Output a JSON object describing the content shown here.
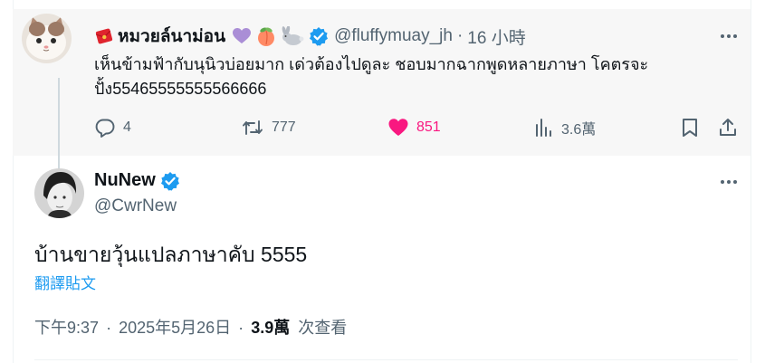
{
  "parent_tweet": {
    "display_name": "หมวยล์นาม่อน",
    "name_emojis": [
      "purple-heart",
      "peach",
      "rabbit"
    ],
    "handle": "@fluffymuay_jh",
    "separator": "·",
    "time": "16 小時",
    "text": "เห็นข้ามฟ้ากับนุนิวบ่อยมาก เด่วต้องไปดูละ ชอบมากฉากพูดหลายภาษา โคตรจะปั้ง55465555555566666",
    "stats": {
      "replies": "4",
      "retweets": "777",
      "likes": "851",
      "views": "3.6萬"
    }
  },
  "main_tweet": {
    "display_name": "NuNew",
    "handle": "@CwrNew",
    "text": "บ้านขายวุ้นแปลภาษาคับ 5555",
    "translate_label": "翻譯貼文",
    "time": "下午9:37",
    "separator": "·",
    "date": "2025年5月26日",
    "views_count": "3.9萬",
    "views_label": "次查看"
  },
  "colors": {
    "accent": "#1d9bf0",
    "like": "#f91880",
    "muted": "#536471"
  }
}
